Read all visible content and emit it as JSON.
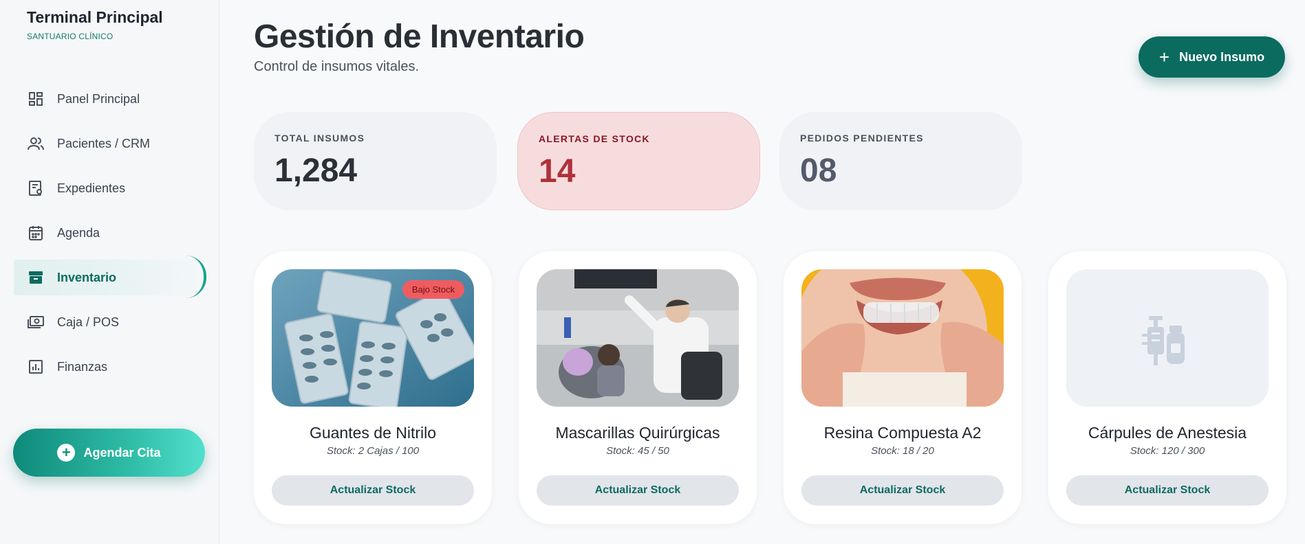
{
  "sidebar": {
    "title": "Terminal Principal",
    "subtitle": "SANTUARIO CLÍNICO",
    "items": [
      {
        "label": "Panel Principal",
        "icon": "dashboard-icon"
      },
      {
        "label": "Pacientes / CRM",
        "icon": "users-icon"
      },
      {
        "label": "Expedientes",
        "icon": "records-icon"
      },
      {
        "label": "Agenda",
        "icon": "calendar-icon"
      },
      {
        "label": "Inventario",
        "icon": "inventory-icon",
        "active": true
      },
      {
        "label": "Caja / POS",
        "icon": "cash-icon"
      },
      {
        "label": "Finanzas",
        "icon": "finance-chart-icon"
      }
    ],
    "cta_label": "Agendar Cita"
  },
  "header": {
    "title": "Gestión de Inventario",
    "subtitle": "Control de insumos vitales.",
    "new_button": "Nuevo Insumo"
  },
  "stats": [
    {
      "label": "TOTAL INSUMOS",
      "value": "1,284"
    },
    {
      "label": "ALERTAS DE STOCK",
      "value": "14"
    },
    {
      "label": "PEDIDOS PENDIENTES",
      "value": "08"
    }
  ],
  "products": [
    {
      "name": "Guantes de Nitrilo",
      "stock": "Stock: 2 Cajas / 100",
      "badge": "Bajo Stock",
      "button": "Actualizar Stock"
    },
    {
      "name": "Mascarillas Quirúrgicas",
      "stock": "Stock: 45 / 50",
      "button": "Actualizar Stock"
    },
    {
      "name": "Resina Compuesta A2",
      "stock": "Stock: 18 / 20",
      "button": "Actualizar Stock"
    },
    {
      "name": "Cárpules de Anestesia",
      "stock": "Stock: 120 / 300",
      "button": "Actualizar Stock"
    }
  ],
  "colors": {
    "accent": "#0b6b5f",
    "alert_bg": "#f7dcde",
    "alert_text": "#b0313a"
  }
}
